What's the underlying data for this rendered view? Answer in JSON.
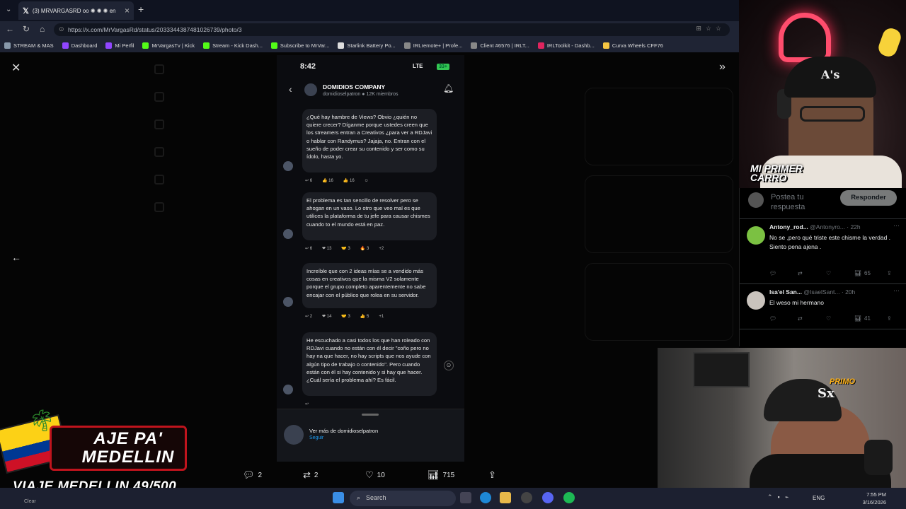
{
  "browser": {
    "tab_title": "(3) MRVARGASRD oo ✺ ✺ ✺ en",
    "new_tab": "+",
    "url": "https://x.com/MrVargasRd/status/2033344387481026739/photo/3",
    "bookmarks": [
      {
        "label": "STREAM & MAS",
        "color": "#8899aa"
      },
      {
        "label": "Dashboard",
        "color": "#9146ff"
      },
      {
        "label": "Mi Perfil",
        "color": "#9146ff"
      },
      {
        "label": "MrVargasTv | Kick",
        "color": "#53fc18"
      },
      {
        "label": "Stream - Kick Dash...",
        "color": "#53fc18"
      },
      {
        "label": "Subscribe to MrVar...",
        "color": "#53fc18"
      },
      {
        "label": "Starlink Battery Po...",
        "color": "#dddddd"
      },
      {
        "label": "IRLremote+ | Profe...",
        "color": "#888888"
      },
      {
        "label": "Client #6576 | IRLT...",
        "color": "#888888"
      },
      {
        "label": "IRLToolkit - Dashb...",
        "color": "#e0245e"
      },
      {
        "label": "Curva Wheels CFF76",
        "color": "#f5c542"
      }
    ]
  },
  "photo_viewer": {
    "close_icon": "close-icon",
    "next_icon": "chevron-right-icon",
    "prev_icon": "arrow-left-icon"
  },
  "phone": {
    "time": "8:42",
    "network": "LTE",
    "battery": "33+",
    "group_name": "DOMIDIOS COMPANY",
    "group_sub": "domidioselpatron ● 12K miembros",
    "messages": [
      {
        "text": "¿Qué hay hambre de Views? Obvio ¿quién no quiere crecer? Díganme porque ustedes creen que los streamers entran a Creativos ¿para ver a RDJavi o hablar con Randymus? Jajaja, no. Entran con el sueño de poder crear su contenido y ser como su ídolo, hasta yo.",
        "reactions": [
          "↩ 6",
          "👍 16",
          "👍 16",
          "☺"
        ]
      },
      {
        "text": "El problema es tan sencillo de resolver pero se ahogan en un vaso. Lo otro que veo mal es que utilices la plataforma de tu jefe para causar chismes cuando to el mundo está en paz.",
        "reactions": [
          "↩ 6",
          "❤ 13",
          "🤝 3",
          "🔥 3",
          "+2"
        ]
      },
      {
        "text": "Increíble que con 2 ideas mías se a vendido más cosas en creativos que la misma V2 solamente porque el grupo completo aparentemente no sabe encajar con el público que rolea en su servidor.",
        "reactions": [
          "↩ 2",
          "❤ 14",
          "🤝 3",
          "👍 5",
          "+1"
        ]
      },
      {
        "text": "He escuchado a casi todos los que han roleado con RDJavi cuando no están con él decir \"coño pero no hay na que hacer, no hay scripts que nos ayude con algún tipo de trabajo o contenido\". Pero cuando están con él si hay contenido y si hay que hacer. ¿Cuál sería el problema ahí? Es fácil.",
        "reactions": [
          "↩"
        ]
      }
    ],
    "footer_text": "Ver más de domidioselpatron",
    "footer_follow": "Seguir"
  },
  "tweet_actions": {
    "replies": "2",
    "reposts": "2",
    "likes": "10",
    "views": "715"
  },
  "replies_panel": {
    "placeholder": "Postea tu respuesta",
    "reply_button": "Responder",
    "replies": [
      {
        "name": "Antony_rod...",
        "handle": "@Antonyro...",
        "time": "· 22h",
        "text": "No se ,pero qué triste este chisme la verdad .\nSiento pena ajena .",
        "views": "65",
        "avatar_color": "#7bc142"
      },
      {
        "name": "Isa'el San...",
        "handle": "@IsaelSant...",
        "time": "· 20h",
        "text": "El weso mi hermano",
        "views": "41",
        "avatar_color": "#c9c3bd"
      }
    ]
  },
  "overlays": {
    "cam_label": "MI PRIMER\nCARRO",
    "cam_badge": "PRIMO",
    "trip_title": "VIAJE PA' MEDELLIN",
    "trip_counter": "VIAJE MEDELLIN 49/500"
  },
  "taskbar": {
    "search": "Search",
    "weather": "Clear",
    "lang": "ENG",
    "time": "7:55 PM",
    "date": "3/16/2026"
  }
}
